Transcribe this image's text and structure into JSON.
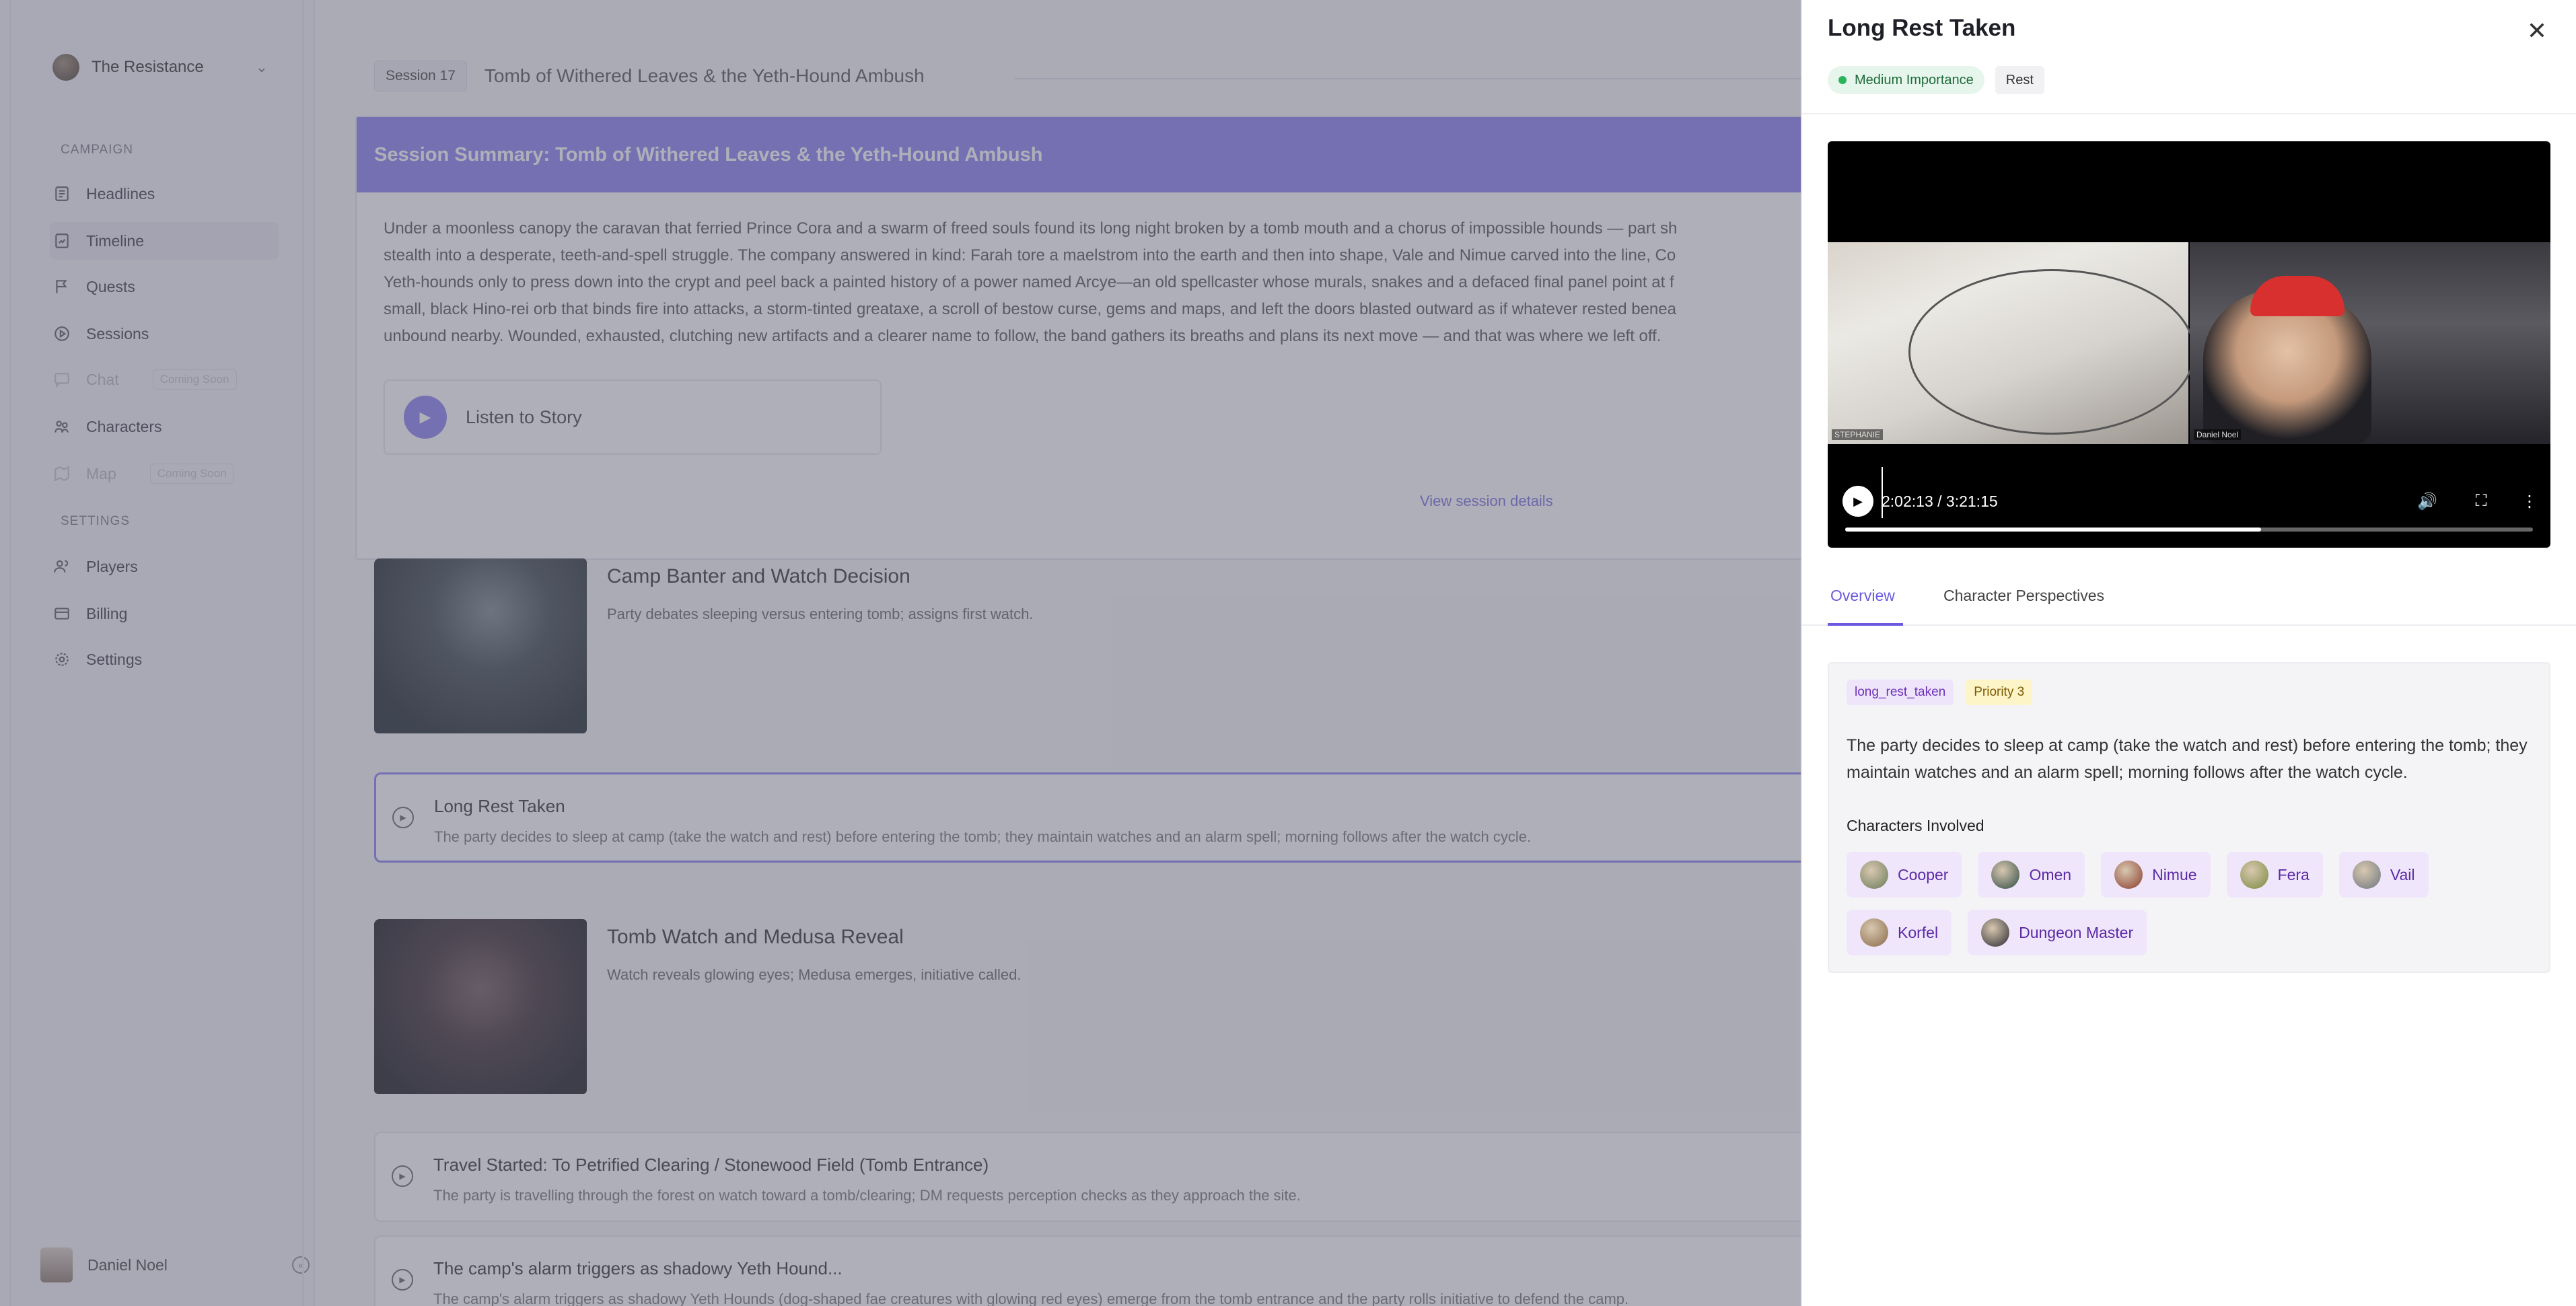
{
  "sidebar": {
    "campaign_name": "The Resistance",
    "sections": {
      "campaign": "CAMPAIGN",
      "settings": "SETTINGS"
    },
    "items": [
      {
        "label": "Headlines",
        "icon": "newspaper-icon"
      },
      {
        "label": "Timeline",
        "icon": "timeline-icon",
        "active": true
      },
      {
        "label": "Quests",
        "icon": "flag-icon"
      },
      {
        "label": "Sessions",
        "icon": "play-circle-icon"
      },
      {
        "label": "Chat",
        "icon": "chat-icon",
        "disabled": true,
        "badge": "Coming Soon"
      },
      {
        "label": "Characters",
        "icon": "characters-icon"
      },
      {
        "label": "Map",
        "icon": "map-icon",
        "disabled": true,
        "badge": "Coming Soon"
      },
      {
        "label": "Players",
        "icon": "users-icon"
      },
      {
        "label": "Billing",
        "icon": "credit-card-icon"
      },
      {
        "label": "Settings",
        "icon": "gear-icon"
      }
    ],
    "user_name": "Daniel Noel"
  },
  "main": {
    "session_pill": "Session 17",
    "session_title": "Tomb of Withered Leaves & the Yeth-Hound Ambush",
    "summary_title": "Session Summary: Tomb of Withered Leaves & the Yeth-Hound Ambush",
    "summary_lines": [
      "Under a moonless canopy the caravan that ferried Prince Cora and a swarm of freed souls found its long night broken by a tomb mouth and a chorus of impossible hounds — part sh",
      "stealth into a desperate, teeth-and-spell struggle. The company answered in kind: Farah tore a maelstrom into the earth and then into shape, Vale and Nimue carved into the line, Co",
      "Yeth-hounds only to press down into the crypt and peel back a painted history of a power named Arcye—an old spellcaster whose murals, snakes and a defaced final panel point at f",
      "small, black Hino-rei orb that binds fire into attacks, a storm-tinted greataxe, a scroll of bestow curse, gems and maps, and left the doors blasted outward as if whatever rested benea",
      "unbound nearby. Wounded, exhausted, clutching new artifacts and a clearer name to follow, the band gathers its breaths and plans its next move — and that was where we left off."
    ],
    "listen_label": "Listen to Story",
    "view_details": "View session details",
    "events": [
      {
        "title": "Camp Banter and Watch Decision",
        "desc": "Party debates sleeping versus entering tomb; assigns first watch."
      },
      {
        "title": "Long Rest Taken",
        "desc": "The party decides to sleep at camp (take the watch and rest) before entering the tomb; they maintain watches and an alarm spell; morning follows after the watch cycle."
      },
      {
        "title": "Tomb Watch and Medusa Reveal",
        "desc": "Watch reveals glowing eyes; Medusa emerges, initiative called."
      },
      {
        "title": "Travel Started: To Petrified Clearing / Stonewood Field (Tomb Entrance)",
        "desc": "The party is travelling through the forest on watch toward a tomb/clearing; DM requests perception checks as they approach the site."
      },
      {
        "title": "The camp's alarm triggers as shadowy Yeth Hound...",
        "desc": "The camp's alarm triggers as shadowy Yeth Hounds (dog-shaped fae creatures with glowing red eyes) emerge from the tomb entrance and the party rolls initiative to defend the camp."
      }
    ]
  },
  "drawer": {
    "title": "Long Rest Taken",
    "importance": "Medium Importance",
    "category": "Rest",
    "video": {
      "time": "2:02:13 / 3:21:15",
      "progress": 0.605,
      "cam_left": "STEPHANIE",
      "cam_right": "Daniel Noel"
    },
    "tabs": [
      "Overview",
      "Character Perspectives"
    ],
    "tags": [
      "long_rest_taken",
      "Priority 3"
    ],
    "description": "The party decides to sleep at camp (take the watch and rest) before entering the tomb; they maintain watches and an alarm spell; morning follows after the watch cycle.",
    "characters_label": "Characters Involved",
    "characters": [
      {
        "name": "Cooper",
        "color": "#6b7a5a"
      },
      {
        "name": "Omen",
        "color": "#2f4a44"
      },
      {
        "name": "Nimue",
        "color": "#8a3b2c"
      },
      {
        "name": "Fera",
        "color": "#7b8a3e"
      },
      {
        "name": "Vail",
        "color": "#6d7580"
      },
      {
        "name": "Korfel",
        "color": "#8a6a4a"
      },
      {
        "name": "Dungeon Master",
        "color": "#2a2a30"
      }
    ]
  },
  "colors": {
    "accent": "#8b80f0",
    "tab_active": "#6b5ae0",
    "importance_dot": "#2bb55a"
  }
}
